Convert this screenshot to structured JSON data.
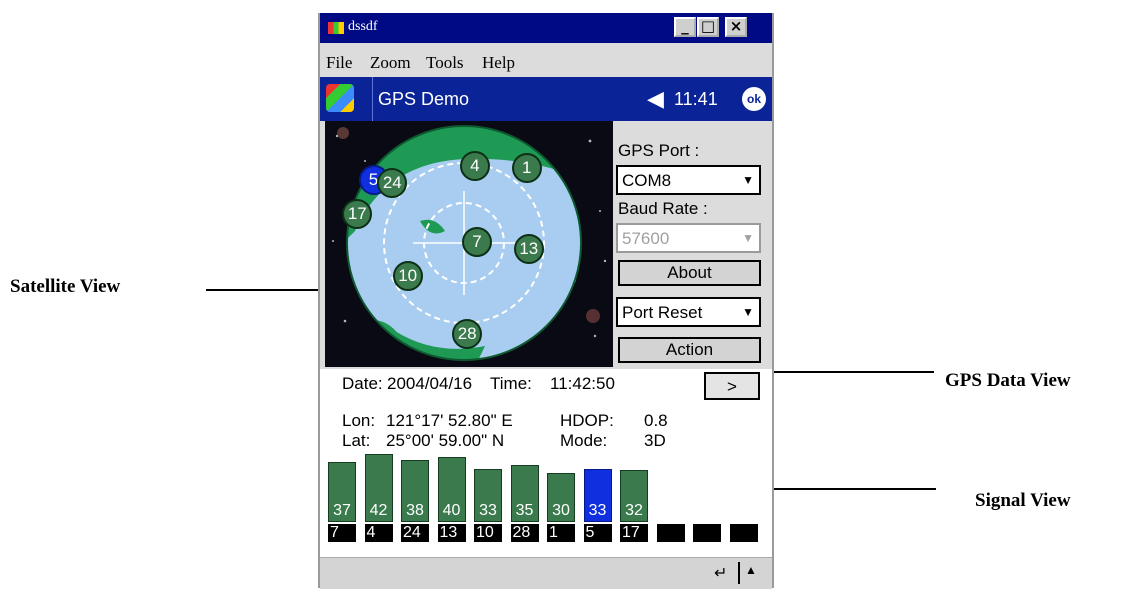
{
  "annotations": {
    "satellite_view": "Satellite View",
    "gps_data_view": "GPS Data View",
    "signal_view": "Signal View"
  },
  "window": {
    "title": "dssdf",
    "minimize": "_",
    "maximize": "□",
    "close": "×"
  },
  "menu": [
    "File",
    "Zoom",
    "Tools",
    "Help"
  ],
  "nav": {
    "app_title": "GPS Demo",
    "time": "11:41",
    "ok": "ok"
  },
  "controls": {
    "gps_port_label": "GPS Port :",
    "gps_port_value": "COM8",
    "baud_rate_label": "Baud Rate :",
    "baud_rate_value": "57600",
    "about_label": "About",
    "port_reset_value": "Port Reset",
    "action_label": "Action"
  },
  "gps_data": {
    "date_label": "Date:",
    "date": "2004/04/16",
    "time_label": "Time:",
    "time": "11:42:50",
    "more_button": ">",
    "lon_label": "Lon:",
    "lon": "121°17' 52.80\" E",
    "hdop_label": "HDOP:",
    "hdop": "0.8",
    "lat_label": "Lat:",
    "lat": "25°00' 59.00\" N",
    "mode_label": "Mode:",
    "mode": "3D"
  },
  "satellites": [
    {
      "id": "5",
      "azimuth": 305,
      "elevation": 5,
      "highlight": true
    },
    {
      "id": "24",
      "azimuth": 310,
      "elevation": 18,
      "highlight": false
    },
    {
      "id": "4",
      "azimuth": 8,
      "elevation": 30,
      "highlight": false
    },
    {
      "id": "1",
      "azimuth": 40,
      "elevation": 15,
      "highlight": false
    },
    {
      "id": "17",
      "azimuth": 285,
      "elevation": 5,
      "highlight": false
    },
    {
      "id": "7",
      "azimuth": 85,
      "elevation": 80,
      "highlight": false
    },
    {
      "id": "13",
      "azimuth": 95,
      "elevation": 40,
      "highlight": false
    },
    {
      "id": "10",
      "azimuth": 240,
      "elevation": 40,
      "highlight": false
    },
    {
      "id": "28",
      "azimuth": 178,
      "elevation": 20,
      "highlight": false
    }
  ],
  "signals": [
    {
      "prn": "7",
      "snr": 37,
      "highlight": false
    },
    {
      "prn": "4",
      "snr": 42,
      "highlight": false
    },
    {
      "prn": "24",
      "snr": 38,
      "highlight": false
    },
    {
      "prn": "13",
      "snr": 40,
      "highlight": false
    },
    {
      "prn": "10",
      "snr": 33,
      "highlight": false
    },
    {
      "prn": "28",
      "snr": 35,
      "highlight": false
    },
    {
      "prn": "1",
      "snr": 30,
      "highlight": false
    },
    {
      "prn": "5",
      "snr": 33,
      "highlight": true
    },
    {
      "prn": "17",
      "snr": 32,
      "highlight": false
    },
    {
      "prn": "",
      "snr": null,
      "highlight": false
    },
    {
      "prn": "",
      "snr": null,
      "highlight": false
    },
    {
      "prn": "",
      "snr": null,
      "highlight": false
    }
  ],
  "colors": {
    "sat_green": "#3a7a4c",
    "sat_blue": "#1030e0",
    "earth_land": "#1f9a55",
    "earth_sea": "#a9cdf0",
    "title_bar": "#000a84",
    "nav_bar": "#0a2396"
  },
  "icons": {
    "app": "app-icon",
    "start": "windows-flag-icon",
    "volume": "speaker-icon",
    "sip": "keyboard-input-icon",
    "sip_arrow": "up-arrow-icon"
  }
}
